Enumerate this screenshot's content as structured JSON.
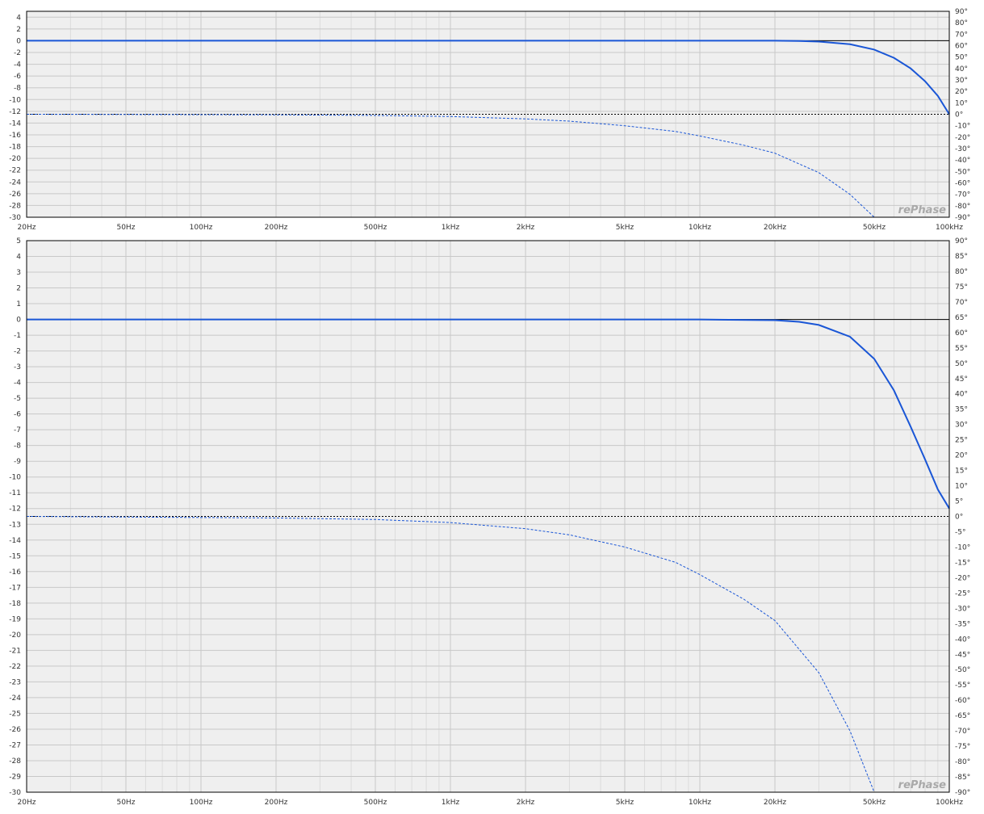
{
  "watermark": "rePhase",
  "colors": {
    "plot_bg": "#efefef",
    "grid_major": "#c8c8c8",
    "grid_minor": "#dcdcdc",
    "curve": "#1a56d6",
    "zero_line": "#000000"
  },
  "x_ticks": [
    "20Hz",
    "50Hz",
    "100Hz",
    "200Hz",
    "500Hz",
    "1kHz",
    "2kHz",
    "5kHz",
    "10kHz",
    "20kHz",
    "50kHz",
    "100kHz"
  ],
  "chart_data": [
    {
      "type": "line",
      "x_scale": "log",
      "xlim": [
        20,
        100000
      ],
      "ylim_left": [
        -30,
        5
      ],
      "ylim_right": [
        -90,
        90
      ],
      "left_ticks": [
        "4",
        "2",
        "0",
        "-2",
        "-4",
        "-6",
        "-8",
        "-10",
        "-12",
        "-14",
        "-16",
        "-18",
        "-20",
        "-22",
        "-24",
        "-26",
        "-28",
        "-30"
      ],
      "right_ticks": [
        "90°",
        "80°",
        "70°",
        "60°",
        "50°",
        "40°",
        "30°",
        "20°",
        "10°",
        "0°",
        "-10°",
        "-20°",
        "-30°",
        "-40°",
        "-50°",
        "-60°",
        "-70°",
        "-80°",
        "-90°"
      ],
      "grid": true,
      "series": [
        {
          "axis": "left",
          "style": "solid",
          "x": [
            20,
            10000,
            20000,
            25000,
            30000,
            40000,
            50000,
            60000,
            70000,
            80000,
            90000,
            100000
          ],
          "y": [
            0,
            0,
            0,
            -0.05,
            -0.15,
            -0.6,
            -1.5,
            -2.9,
            -4.7,
            -6.9,
            -9.4,
            -12.5
          ]
        },
        {
          "axis": "right",
          "style": "dashed",
          "x": [
            20,
            200,
            500,
            1000,
            2000,
            3000,
            5000,
            8000,
            10000,
            15000,
            20000,
            30000,
            40000,
            50000
          ],
          "y": [
            0,
            -0.5,
            -1,
            -2,
            -4,
            -6,
            -10,
            -15,
            -19,
            -27,
            -34,
            -51,
            -70,
            -90
          ]
        }
      ]
    },
    {
      "type": "line",
      "x_scale": "log",
      "xlim": [
        20,
        100000
      ],
      "ylim_left": [
        -30,
        5
      ],
      "ylim_right": [
        -90,
        90
      ],
      "left_ticks": [
        "5",
        "4",
        "3",
        "2",
        "1",
        "0",
        "-1",
        "-2",
        "-3",
        "-4",
        "-5",
        "-6",
        "-7",
        "-8",
        "-9",
        "-10",
        "-11",
        "-12",
        "-13",
        "-14",
        "-15",
        "-16",
        "-17",
        "-18",
        "-19",
        "-20",
        "-21",
        "-22",
        "-23",
        "-24",
        "-25",
        "-26",
        "-27",
        "-28",
        "-29",
        "-30"
      ],
      "right_ticks": [
        "90°",
        "85°",
        "80°",
        "75°",
        "70°",
        "65°",
        "60°",
        "55°",
        "50°",
        "45°",
        "40°",
        "35°",
        "30°",
        "25°",
        "20°",
        "15°",
        "10°",
        "5°",
        "0°",
        "-5°",
        "-10°",
        "-15°",
        "-20°",
        "-25°",
        "-30°",
        "-35°",
        "-40°",
        "-45°",
        "-50°",
        "-55°",
        "-60°",
        "-65°",
        "-70°",
        "-75°",
        "-80°",
        "-85°",
        "-90°"
      ],
      "grid": true,
      "series": [
        {
          "axis": "left",
          "style": "solid",
          "x": [
            20,
            10000,
            20000,
            25000,
            30000,
            40000,
            50000,
            60000,
            70000,
            80000,
            90000,
            100000
          ],
          "y": [
            0,
            0,
            -0.05,
            -0.15,
            -0.35,
            -1.1,
            -2.5,
            -4.5,
            -6.8,
            -8.9,
            -10.8,
            -12
          ]
        },
        {
          "axis": "right",
          "style": "dashed",
          "x": [
            20,
            200,
            500,
            1000,
            2000,
            3000,
            5000,
            8000,
            10000,
            15000,
            20000,
            30000,
            40000,
            50000
          ],
          "y": [
            0,
            -0.5,
            -1,
            -2,
            -4,
            -6,
            -10,
            -15,
            -19,
            -27,
            -34,
            -51,
            -70,
            -90
          ]
        }
      ]
    }
  ]
}
